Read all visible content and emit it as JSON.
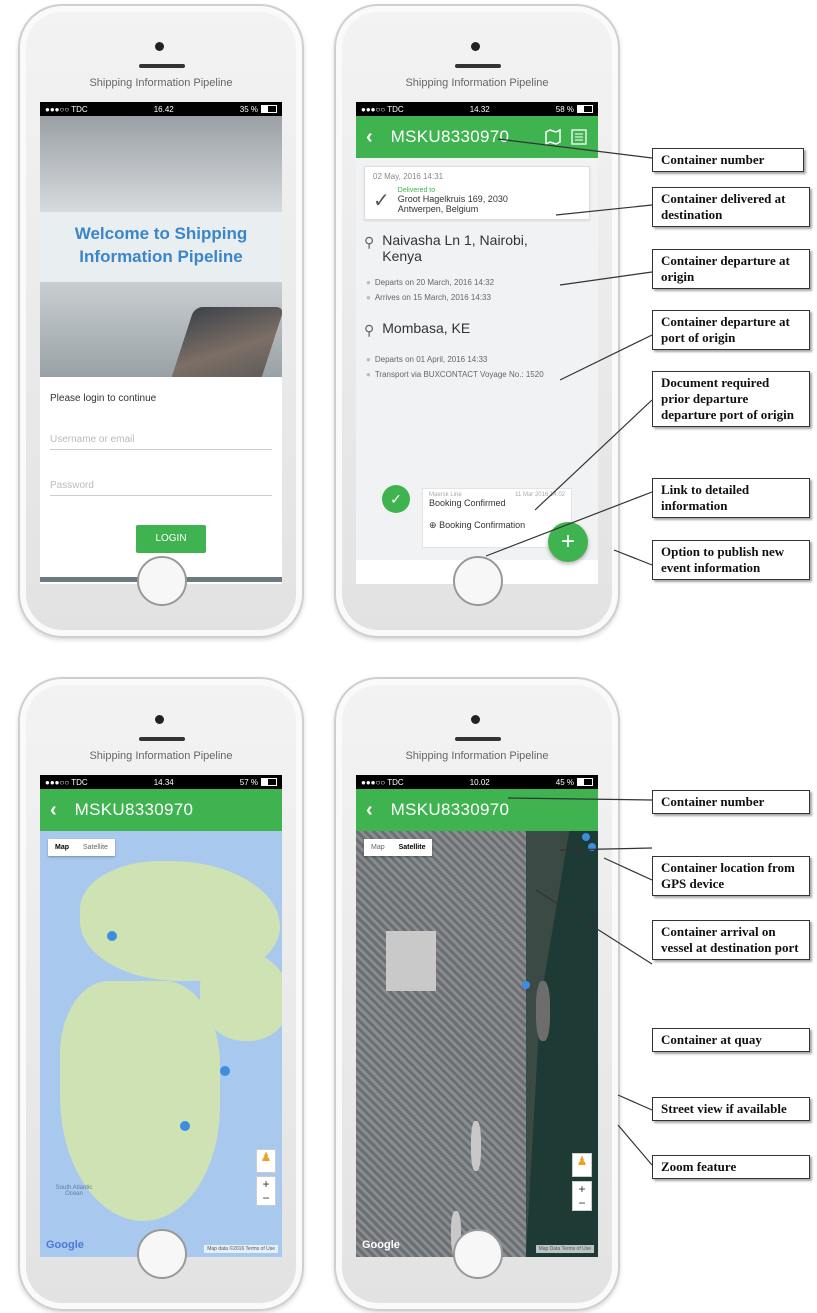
{
  "common": {
    "brand": "Shipping Information Pipeline"
  },
  "phone1": {
    "status": {
      "carrier": "●●●○○ TDC",
      "time": "16.42",
      "battery": "35 %"
    },
    "welcome_line1": "Welcome to Shipping",
    "welcome_line2": "Information Pipeline",
    "login_prompt": "Please login to continue",
    "username_placeholder": "Username or email",
    "password_placeholder": "Password",
    "login_button": "LOGIN"
  },
  "phone2": {
    "status": {
      "carrier": "●●●○○ TDC",
      "time": "14.32",
      "battery": "58 %"
    },
    "header_title": "MSKU8330970",
    "delivered": {
      "date": "02 May, 2016 14:31",
      "label": "Delivered to",
      "address_line1": "Groot Hagelkruis 169, 2030",
      "address_line2": "Antwerpen, Belgium"
    },
    "origin": {
      "line1": "Naivasha Ln 1, Nairobi,",
      "line2": "Kenya"
    },
    "origin_events": [
      "Departs on 20 March, 2016 14:32",
      "Arrives on 15 March, 2016 14:33"
    ],
    "port": "Mombasa, KE",
    "port_events": [
      "Departs on 01 April, 2016 14:33",
      "Transport via BUXCONTACT Voyage No.: 1520"
    ],
    "booking": {
      "source": "Maersk Line",
      "stamp": "11 Mar 2016 14:02",
      "title": "Booking Confirmed",
      "link": "Booking Confirmation"
    }
  },
  "phone3": {
    "status": {
      "carrier": "●●●○○ TDC",
      "time": "14.34",
      "battery": "57 %"
    },
    "header_title": "MSKU8330970",
    "map_type": [
      "Map",
      "Satellite"
    ],
    "ocean_label": "South Atlantic Ocean",
    "footer": "Map data ©2016 Terms of Use"
  },
  "phone4": {
    "status": {
      "carrier": "●●●○○ TDC",
      "time": "10.02",
      "battery": "45 %"
    },
    "header_title": "MSKU8330970",
    "map_type": [
      "Map",
      "Satellite"
    ],
    "footer": "Map Data Terms of Use"
  },
  "google_logo": "Google",
  "callouts": {
    "c1": "Container number",
    "c2": "Container delivered at destination",
    "c3": "Container departure at origin",
    "c4": "Container departure at port of origin",
    "c5": "Document required prior departure departure port of origin",
    "c6": "Link to detailed information",
    "c7": "Option to publish new event information",
    "c8": "Container number",
    "c9": "Container location from GPS device",
    "c10": "Container arrival on vessel at destination port",
    "c11": "Container at quay",
    "c12": "Street view if available",
    "c13": "Zoom feature"
  }
}
